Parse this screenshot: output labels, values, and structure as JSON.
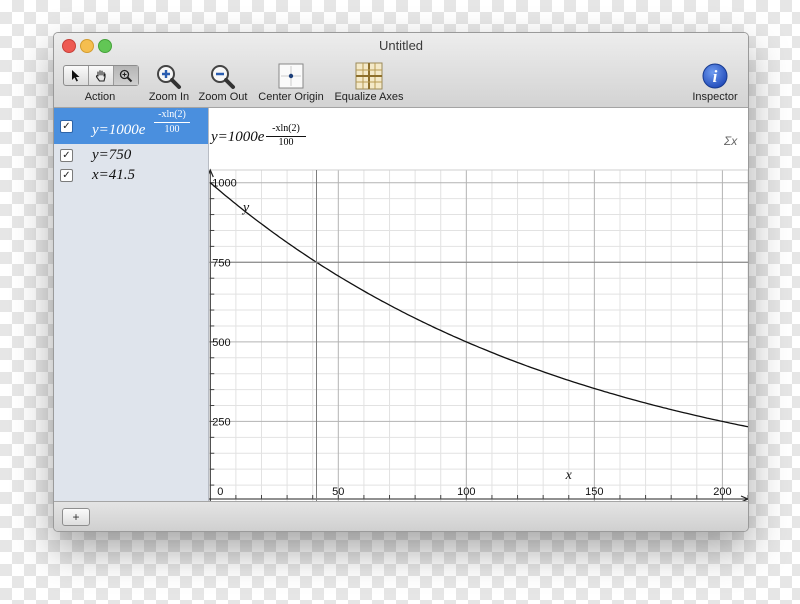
{
  "window": {
    "title": "Untitled"
  },
  "toolbar": {
    "action_label": "Action",
    "zoom_in_label": "Zoom In",
    "zoom_out_label": "Zoom Out",
    "center_origin_label": "Center Origin",
    "equalize_axes_label": "Equalize Axes",
    "inspector_label": "Inspector",
    "inspector_glyph": "i"
  },
  "sidebar": {
    "items": [
      {
        "checked": true,
        "prefix": "y=1000e",
        "exponent_num": "-xln(2)",
        "exponent_den": "100",
        "selected": true
      },
      {
        "checked": true,
        "text": "y=750",
        "selected": false
      },
      {
        "checked": true,
        "text": "x=41.5",
        "selected": false
      }
    ],
    "check_glyph": "✓"
  },
  "editor": {
    "prefix": "y=1000e",
    "exponent_num": "-xln(2)",
    "exponent_den": "100",
    "sigma_glyph": "Σx"
  },
  "bottombar": {
    "add_glyph": "+"
  },
  "chart_data": {
    "type": "line",
    "xlim": [
      -0.5,
      210
    ],
    "ylim": [
      0,
      1040
    ],
    "x_ticks": [
      "0",
      "50",
      "100",
      "150",
      "200"
    ],
    "y_ticks": [
      "1000",
      "750",
      "500",
      "250"
    ],
    "x_label": "x",
    "y_label": "y",
    "grid": true,
    "series": [
      {
        "equation": "y=1000e^(-xln(2)/100)",
        "x": [
          0,
          20,
          41.5,
          60,
          80,
          100,
          120,
          150,
          180,
          210
        ],
        "y": [
          1000,
          871,
          750,
          660,
          574,
          500,
          435,
          354,
          287,
          232
        ]
      },
      {
        "equation": "y=750",
        "x": [
          0,
          210
        ],
        "y": [
          750,
          750
        ]
      },
      {
        "equation": "x=41.5",
        "x": [
          41.5,
          41.5
        ],
        "y": [
          0,
          1040
        ]
      }
    ],
    "colors": {
      "curve": "#111111",
      "major_grid": "#b3b3b3",
      "minor_grid": "#e2e2e2",
      "sidebar_selection": "#4a8fde"
    }
  }
}
